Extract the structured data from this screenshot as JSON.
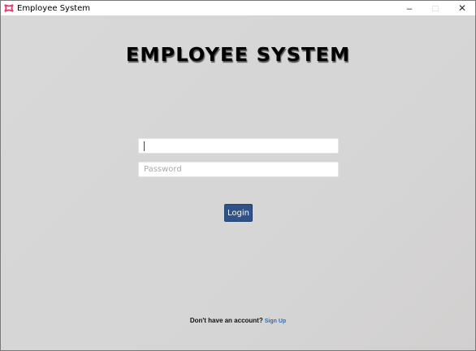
{
  "window": {
    "title": "Employee System",
    "controls": [
      "minimize",
      "maximize",
      "close"
    ]
  },
  "main": {
    "heading": "EMPLOYEE SYSTEM",
    "username": {
      "value": "",
      "placeholder": ""
    },
    "password": {
      "value": "",
      "placeholder": "Password"
    },
    "login_label": "Login",
    "signup_prompt": "Don't have an account?",
    "signup_link": "Sign Up"
  },
  "colors": {
    "button": "#2f5288",
    "link": "#2f6fb3",
    "background": "#d8d8d8"
  }
}
